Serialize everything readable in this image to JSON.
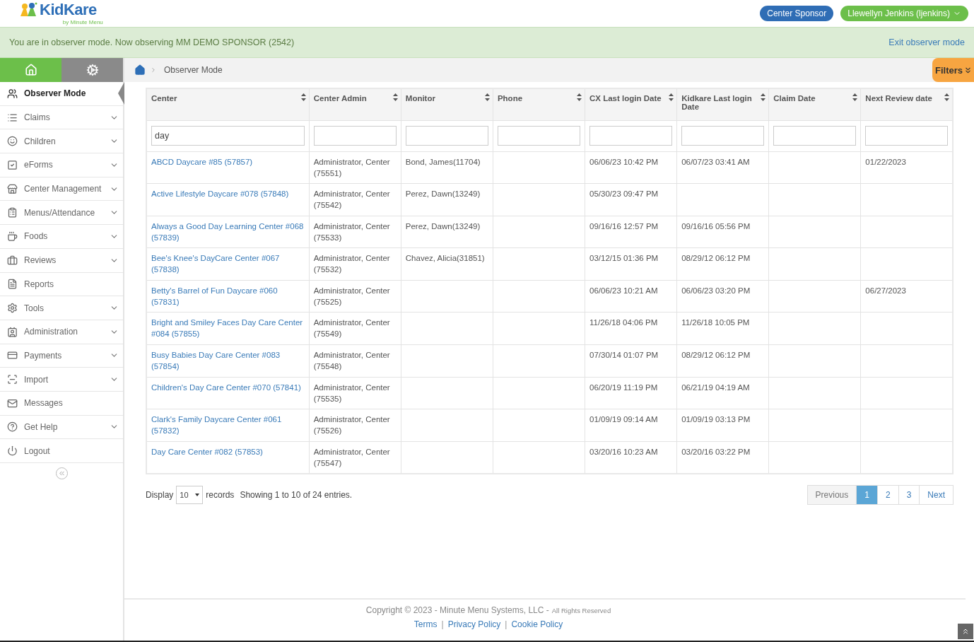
{
  "header": {
    "logo": {
      "name": "KidKare",
      "tagline": "by Minute Menu"
    },
    "role_button": "Center Sponsor",
    "user_menu": "Llewellyn Jenkins (ljenkins)"
  },
  "banner": {
    "message": "You are in observer mode. Now observing MM DEMO SPONSOR (2542)",
    "exit_link": "Exit observer mode"
  },
  "sidebar": {
    "tabs": [
      {
        "kind": "home",
        "selected": true
      },
      {
        "kind": "settings",
        "selected": false
      }
    ],
    "items": [
      {
        "label": "Observer Mode",
        "selected": true,
        "expandable": false
      },
      {
        "label": "Claims",
        "selected": false,
        "expandable": true
      },
      {
        "label": "Children",
        "selected": false,
        "expandable": true
      },
      {
        "label": "eForms",
        "selected": false,
        "expandable": true
      },
      {
        "label": "Center Management",
        "selected": false,
        "expandable": true
      },
      {
        "label": "Menus/Attendance",
        "selected": false,
        "expandable": true
      },
      {
        "label": "Foods",
        "selected": false,
        "expandable": true
      },
      {
        "label": "Reviews",
        "selected": false,
        "expandable": true
      },
      {
        "label": "Reports",
        "selected": false,
        "expandable": false
      },
      {
        "label": "Tools",
        "selected": false,
        "expandable": true
      },
      {
        "label": "Administration",
        "selected": false,
        "expandable": true
      },
      {
        "label": "Payments",
        "selected": false,
        "expandable": true
      },
      {
        "label": "Import",
        "selected": false,
        "expandable": true
      },
      {
        "label": "Messages",
        "selected": false,
        "expandable": false
      },
      {
        "label": "Get Help",
        "selected": false,
        "expandable": true
      },
      {
        "label": "Logout",
        "selected": false,
        "expandable": false
      }
    ]
  },
  "breadcrumb": {
    "current": "Observer Mode"
  },
  "filters_button": "Filters",
  "table": {
    "columns": [
      "Center",
      "Center Admin",
      "Monitor",
      "Phone",
      "CX Last login Date",
      "Kidkare Last login Date",
      "Claim Date",
      "Next Review date"
    ],
    "filter_values": {
      "center": "day"
    },
    "rows": [
      {
        "center": "ABCD Daycare #85 (57857)",
        "center_admin": "Administrator, Center (75551)",
        "monitor": "Bond, James(11704)",
        "cx_last_login": "06/06/23 10:42 PM",
        "kidkare_last_login": "06/07/23 03:41 AM",
        "next_review": "01/22/2023"
      },
      {
        "center": "Active Lifestyle Daycare #078 (57848)",
        "center_admin": "Administrator, Center (75542)",
        "monitor": "Perez, Dawn(13249)",
        "cx_last_login": "05/30/23 09:47 PM"
      },
      {
        "center": "Always a Good Day Learning Center #068 (57839)",
        "center_admin": "Administrator, Center (75533)",
        "monitor": "Perez, Dawn(13249)",
        "cx_last_login": "09/16/16 12:57 PM",
        "kidkare_last_login": "09/16/16 05:56 PM"
      },
      {
        "center": "Bee's Knee's DayCare Center #067 (57838)",
        "center_admin": "Administrator, Center (75532)",
        "monitor": "Chavez, Alicia(31851)",
        "cx_last_login": "03/12/15 01:36 PM",
        "kidkare_last_login": "08/29/12 06:12 PM"
      },
      {
        "center": "Betty's Barrel of Fun Daycare #060 (57831)",
        "center_admin": "Administrator, Center (75525)",
        "cx_last_login": "06/06/23 10:21 AM",
        "kidkare_last_login": "06/06/23 03:20 PM",
        "next_review": "06/27/2023"
      },
      {
        "center": "Bright and Smiley Faces Day Care Center #084 (57855)",
        "center_admin": "Administrator, Center (75549)",
        "cx_last_login": "11/26/18 04:06 PM",
        "kidkare_last_login": "11/26/18 10:05 PM"
      },
      {
        "center": "Busy Babies Day Care Center #083 (57854)",
        "center_admin": "Administrator, Center (75548)",
        "cx_last_login": "07/30/14 01:07 PM",
        "kidkare_last_login": "08/29/12 06:12 PM"
      },
      {
        "center": "Children's Day Care Center #070 (57841)",
        "center_admin": "Administrator, Center (75535)",
        "cx_last_login": "06/20/19 11:19 PM",
        "kidkare_last_login": "06/21/19 04:19 AM"
      },
      {
        "center": "Clark's Family Daycare Center #061 (57832)",
        "center_admin": "Administrator, Center (75526)",
        "cx_last_login": "01/09/19 09:14 AM",
        "kidkare_last_login": "01/09/19 03:13 PM"
      },
      {
        "center": "Day Care Center #082 (57853)",
        "center_admin": "Administrator, Center (75547)",
        "cx_last_login": "03/20/16 10:23 AM",
        "kidkare_last_login": "03/20/16 03:22 PM"
      }
    ]
  },
  "table_footer": {
    "display_label": "Display",
    "page_size": "10",
    "records_label": "records",
    "summary": "Showing 1 to 10 of 24 entries."
  },
  "pagination": {
    "previous": "Previous",
    "next": "Next",
    "pages": [
      {
        "label": "1",
        "selected": true
      },
      {
        "label": "2",
        "selected": false
      },
      {
        "label": "3",
        "selected": false
      }
    ]
  },
  "footer": {
    "copyright": "Copyright © 2023 - Minute Menu Systems, LLC -",
    "rights": "All Rights Reserved",
    "links": [
      "Terms",
      "Privacy Policy",
      "Cookie Policy"
    ],
    "link_separator": "|"
  }
}
